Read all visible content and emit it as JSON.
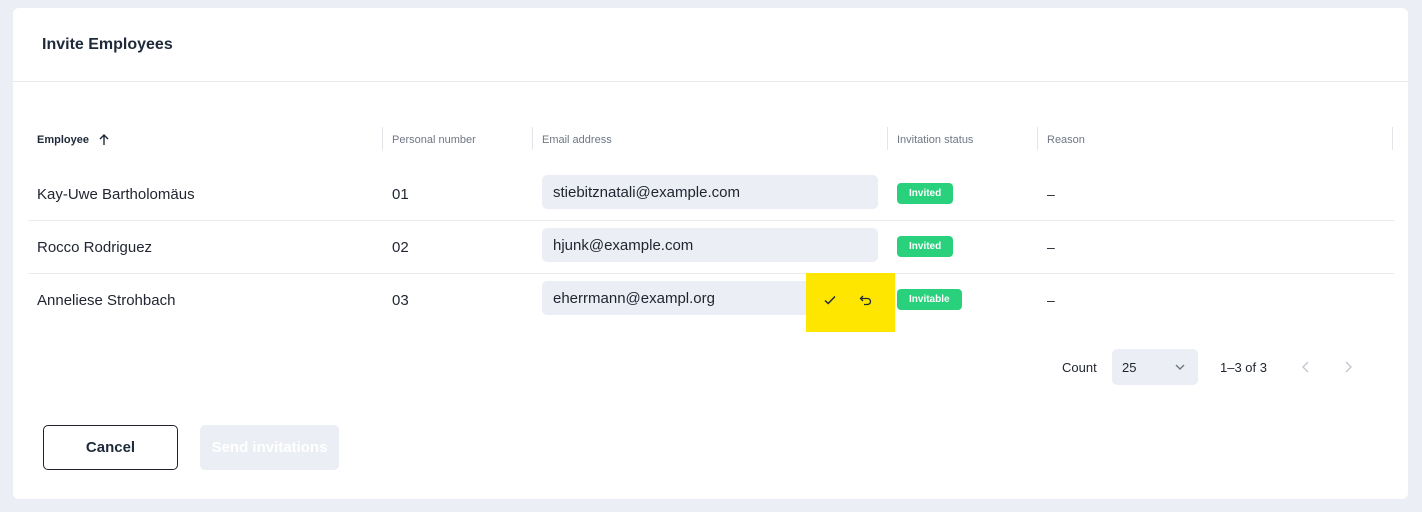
{
  "dialog": {
    "title": "Invite Employees"
  },
  "table": {
    "columns": {
      "employee": "Employee",
      "personal_number": "Personal number",
      "email": "Email address",
      "status": "Invitation status",
      "reason": "Reason"
    },
    "rows": [
      {
        "name": "Kay-Uwe Bartholomäus",
        "number": "01",
        "email": "stiebitznatali@example.com",
        "status": "Invited",
        "reason": "–"
      },
      {
        "name": "Rocco Rodriguez",
        "number": "02",
        "email": "hjunk@example.com",
        "status": "Invited",
        "reason": "–"
      },
      {
        "name": "Anneliese Strohbach",
        "number": "03",
        "email": "eherrmann@exampl.org",
        "status": "Invitable",
        "reason": "–"
      }
    ]
  },
  "pagination": {
    "count_label": "Count",
    "count_value": "25",
    "range": "1–3 of 3"
  },
  "buttons": {
    "cancel": "Cancel",
    "send": "Send invitations"
  },
  "colors": {
    "status_green": "#2ad17d",
    "highlight": "#ffe600",
    "page_bg": "#eceef5"
  },
  "icons": {
    "sort": "arrow-up-icon",
    "confirm": "check-icon",
    "undo": "undo-icon",
    "dropdown": "chevron-down-icon",
    "prev": "chevron-left-icon",
    "next": "chevron-right-icon"
  }
}
